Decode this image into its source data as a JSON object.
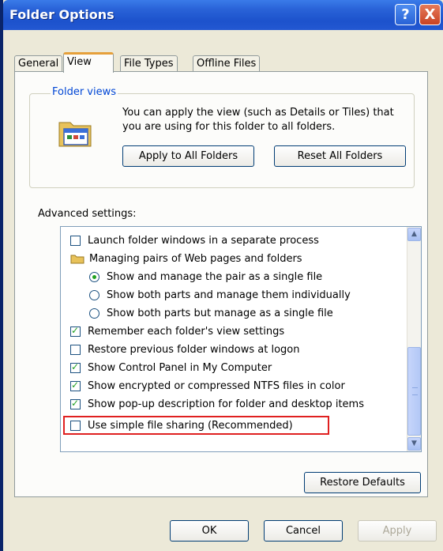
{
  "window": {
    "title": "Folder Options",
    "help_button": "?",
    "close_button": "X"
  },
  "tabs": [
    {
      "label": "General",
      "active": false
    },
    {
      "label": "View",
      "active": true
    },
    {
      "label": "File Types",
      "active": false
    },
    {
      "label": "Offline Files",
      "active": false
    }
  ],
  "folder_views": {
    "legend": "Folder views",
    "icon": "folder-window-icon",
    "description": "You can apply the view (such as Details or Tiles) that you are using for this folder to all folders.",
    "apply_button": "Apply to All Folders",
    "reset_button": "Reset All Folders"
  },
  "advanced": {
    "label": "Advanced settings:",
    "items": [
      {
        "type": "checkbox",
        "checked": false,
        "label": "Launch folder windows in a separate process"
      },
      {
        "type": "folder",
        "label": "Managing pairs of Web pages and folders"
      },
      {
        "type": "radio",
        "checked": true,
        "label": "Show and manage the pair as a single file"
      },
      {
        "type": "radio",
        "checked": false,
        "label": "Show both parts and manage them individually"
      },
      {
        "type": "radio",
        "checked": false,
        "label": "Show both parts but manage as a single file"
      },
      {
        "type": "checkbox",
        "checked": true,
        "label": "Remember each folder's view settings"
      },
      {
        "type": "checkbox",
        "checked": false,
        "label": "Restore previous folder windows at logon"
      },
      {
        "type": "checkbox",
        "checked": true,
        "label": "Show Control Panel in My Computer"
      },
      {
        "type": "checkbox",
        "checked": true,
        "label": "Show encrypted or compressed NTFS files in color"
      },
      {
        "type": "checkbox",
        "checked": true,
        "label": "Show pop-up description for folder and desktop items"
      },
      {
        "type": "checkbox",
        "checked": false,
        "label": "Use simple file sharing (Recommended)"
      }
    ],
    "restore_button": "Restore Defaults"
  },
  "footer": {
    "ok": "OK",
    "cancel": "Cancel",
    "apply": "Apply"
  },
  "colors": {
    "title_bar": "#2a63d8",
    "highlight": "#e02020",
    "check": "#21a121"
  }
}
